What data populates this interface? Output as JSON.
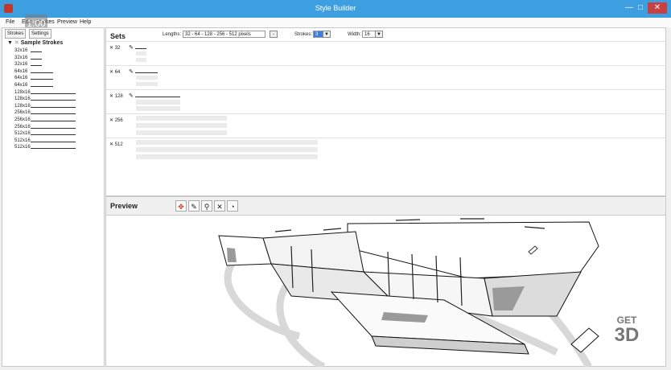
{
  "window": {
    "title": "Style Builder",
    "min": "—",
    "max": "□",
    "close": "✕",
    "app_icon": "app-icon"
  },
  "overlay": {
    "zoom": "1:00"
  },
  "menu": [
    "File",
    "Edit",
    "Strokes",
    "Preview",
    "Help"
  ],
  "left": {
    "tabs": [
      "Strokes",
      "Settings"
    ],
    "root_label": "Sample Strokes",
    "items": [
      "32x16",
      "32x16",
      "32x16",
      "64x16",
      "64x16",
      "64x16",
      "128x16",
      "128x16",
      "128x16",
      "256x16",
      "256x16",
      "256x16",
      "512x16",
      "512x16",
      "512x16"
    ]
  },
  "sets": {
    "title": "Sets",
    "lengths_label": "Lengths:",
    "lengths_value": "32 - 64 - 128 - 256 - 512 pixels",
    "lengths_btn": "-",
    "strokes_label": "Strokes:",
    "strokes_value": "3",
    "width_label": "Width:",
    "width_value": "16",
    "rows": [
      "32",
      "64",
      "128",
      "256",
      "512"
    ]
  },
  "preview": {
    "title": "Preview",
    "tools": [
      "orbit-icon",
      "pencil-icon",
      "zoom-icon",
      "zoom-extents-icon",
      "style-icon"
    ],
    "logo_line1": "GET",
    "logo_line2": "3D"
  },
  "colors": {
    "titlebar": "#3d9fe0",
    "close": "#c94040"
  }
}
